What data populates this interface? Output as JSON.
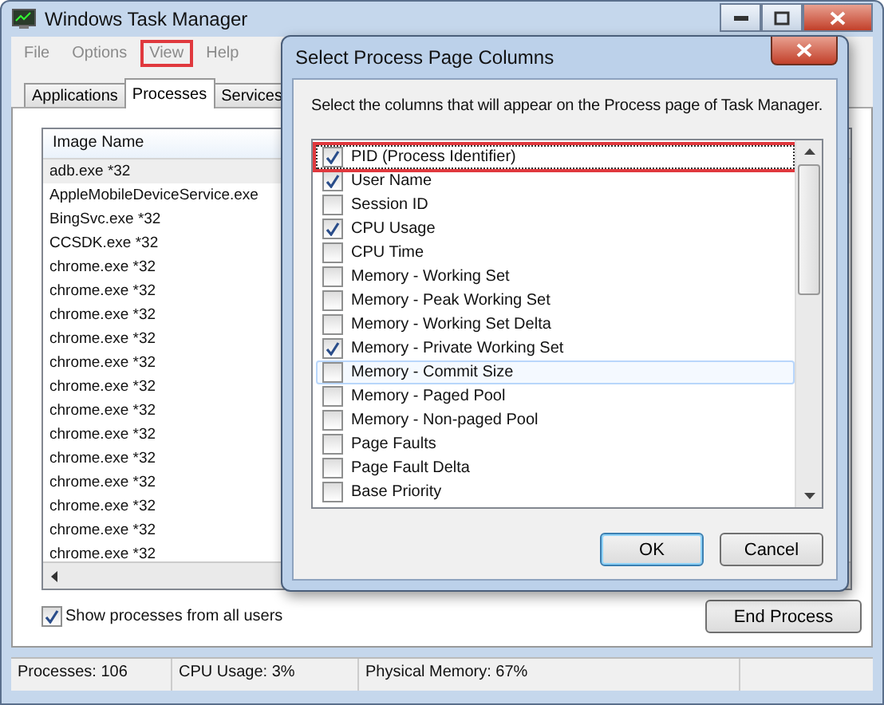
{
  "window": {
    "title": "Windows Task Manager"
  },
  "menu": [
    {
      "label": "File",
      "highlighted": false
    },
    {
      "label": "Options",
      "highlighted": false
    },
    {
      "label": "View",
      "highlighted": true
    },
    {
      "label": "Help",
      "highlighted": false
    }
  ],
  "tabs": [
    {
      "label": "Applications",
      "selected": false
    },
    {
      "label": "Processes",
      "selected": true
    },
    {
      "label": "Services",
      "selected": false
    }
  ],
  "table": {
    "columns": [
      "Image Name"
    ],
    "rows": [
      {
        "name": "adb.exe *32",
        "selected": true
      },
      {
        "name": "AppleMobileDeviceService.exe",
        "selected": false
      },
      {
        "name": "BingSvc.exe *32",
        "selected": false
      },
      {
        "name": "CCSDK.exe *32",
        "selected": false
      },
      {
        "name": "chrome.exe *32",
        "selected": false
      },
      {
        "name": "chrome.exe *32",
        "selected": false
      },
      {
        "name": "chrome.exe *32",
        "selected": false
      },
      {
        "name": "chrome.exe *32",
        "selected": false
      },
      {
        "name": "chrome.exe *32",
        "selected": false
      },
      {
        "name": "chrome.exe *32",
        "selected": false
      },
      {
        "name": "chrome.exe *32",
        "selected": false
      },
      {
        "name": "chrome.exe *32",
        "selected": false
      },
      {
        "name": "chrome.exe *32",
        "selected": false
      },
      {
        "name": "chrome.exe *32",
        "selected": false
      },
      {
        "name": "chrome.exe *32",
        "selected": false
      },
      {
        "name": "chrome.exe *32",
        "selected": false
      },
      {
        "name": "chrome.exe *32",
        "selected": false
      }
    ]
  },
  "show_all_users": {
    "label": "Show processes from all users",
    "checked": true
  },
  "end_button": "End Process",
  "status_bar": [
    "Processes: 106",
    "CPU Usage: 3%",
    "Physical Memory: 67%"
  ],
  "dialog": {
    "title": "Select Process Page Columns",
    "instruction": "Select the columns that will appear on the Process page of Task Manager.",
    "columns": [
      {
        "label": "PID (Process Identifier)",
        "checked": true,
        "highlighted": true,
        "focused": true,
        "hovered": false
      },
      {
        "label": "User Name",
        "checked": true,
        "highlighted": false,
        "focused": false,
        "hovered": false
      },
      {
        "label": "Session ID",
        "checked": false,
        "highlighted": false,
        "focused": false,
        "hovered": false
      },
      {
        "label": "CPU Usage",
        "checked": true,
        "highlighted": false,
        "focused": false,
        "hovered": false
      },
      {
        "label": "CPU Time",
        "checked": false,
        "highlighted": false,
        "focused": false,
        "hovered": false
      },
      {
        "label": "Memory - Working Set",
        "checked": false,
        "highlighted": false,
        "focused": false,
        "hovered": false
      },
      {
        "label": "Memory - Peak Working Set",
        "checked": false,
        "highlighted": false,
        "focused": false,
        "hovered": false
      },
      {
        "label": "Memory - Working Set Delta",
        "checked": false,
        "highlighted": false,
        "focused": false,
        "hovered": false
      },
      {
        "label": "Memory - Private Working Set",
        "checked": true,
        "highlighted": false,
        "focused": false,
        "hovered": false
      },
      {
        "label": "Memory - Commit Size",
        "checked": false,
        "highlighted": false,
        "focused": false,
        "hovered": true
      },
      {
        "label": "Memory - Paged Pool",
        "checked": false,
        "highlighted": false,
        "focused": false,
        "hovered": false
      },
      {
        "label": "Memory - Non-paged Pool",
        "checked": false,
        "highlighted": false,
        "focused": false,
        "hovered": false
      },
      {
        "label": "Page Faults",
        "checked": false,
        "highlighted": false,
        "focused": false,
        "hovered": false
      },
      {
        "label": "Page Fault Delta",
        "checked": false,
        "highlighted": false,
        "focused": false,
        "hovered": false
      },
      {
        "label": "Base Priority",
        "checked": false,
        "highlighted": false,
        "focused": false,
        "hovered": false
      }
    ],
    "buttons": [
      "OK",
      "Cancel"
    ]
  }
}
